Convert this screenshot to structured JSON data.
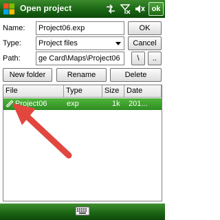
{
  "titlebar": {
    "title": "Open project",
    "ok_label": "ok",
    "icons": [
      "windows-start-icon",
      "connectivity-icon",
      "signal-icon",
      "volume-icon"
    ]
  },
  "form": {
    "name_label": "Name:",
    "name_value": "Project06.exp",
    "type_label": "Type:",
    "type_value": "Project files",
    "path_label": "Path:",
    "path_value": "ge Card\\Maps\\Project06"
  },
  "buttons": {
    "ok": "OK",
    "cancel": "Cancel",
    "path_backslash": "\\",
    "path_up": "..",
    "new_folder": "New folder",
    "rename": "Rename",
    "delete": "Delete"
  },
  "file_list": {
    "columns": [
      "File",
      "Type",
      "Size",
      "Date"
    ],
    "rows": [
      {
        "file": "Project06",
        "type": "exp",
        "size": "1k",
        "date": "201..."
      }
    ]
  },
  "bottombar": {
    "icon": "keyboard-icon"
  },
  "colors": {
    "titlebar_green": "#1f6b18",
    "selection_green": "#3fa12f",
    "arrow_red": "#e2473f"
  }
}
